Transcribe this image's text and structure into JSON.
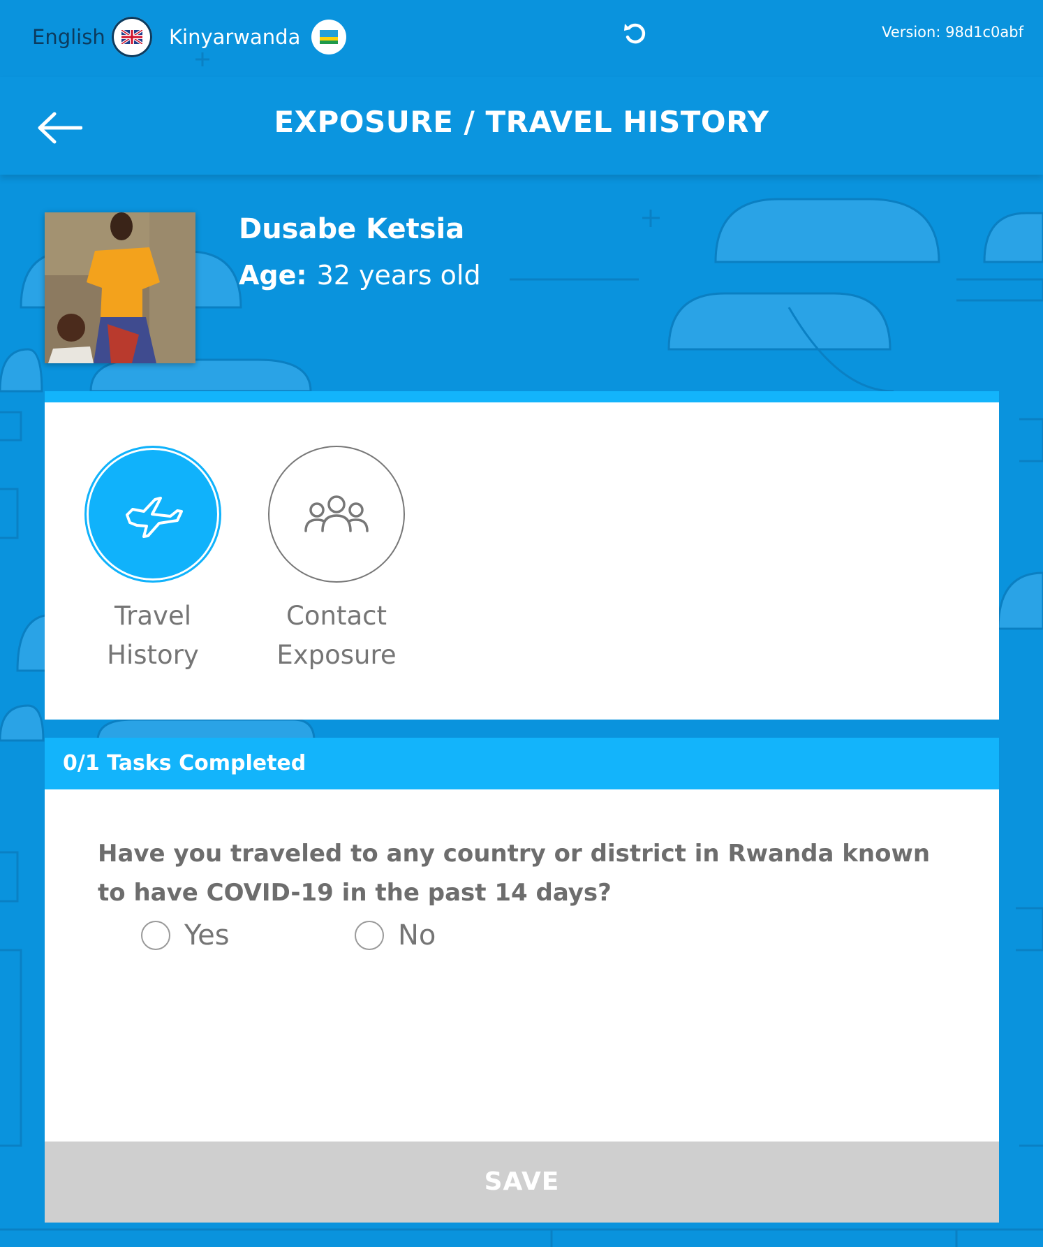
{
  "topbar": {
    "lang_english": "English",
    "lang_kinyarwanda": "Kinyarwanda",
    "version": "Version: 98d1c0abf"
  },
  "header": {
    "title": "EXPOSURE / TRAVEL HISTORY"
  },
  "patient": {
    "name": "Dusabe Ketsia",
    "age_label": "Age:",
    "age_value": "32 years old"
  },
  "tabs": [
    {
      "line1": "Travel",
      "line2": "History",
      "icon": "airplane-icon",
      "active": true
    },
    {
      "line1": "Contact",
      "line2": "Exposure",
      "icon": "people-group-icon",
      "active": false
    }
  ],
  "tasks": {
    "status": "0/1 Tasks Completed"
  },
  "question": {
    "text": "Have you traveled to any country or district in Rwanda known to have COVID-19 in the past 14 days?",
    "options": [
      "Yes",
      "No"
    ]
  },
  "actions": {
    "save_label": "SAVE"
  },
  "colors": {
    "background": "#0a93dd",
    "accent": "#13b4fb",
    "save_disabled": "#cfcfcf"
  }
}
